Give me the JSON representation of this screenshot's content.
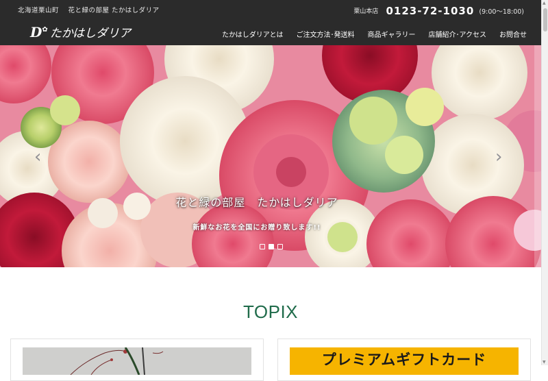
{
  "header": {
    "tagline": "北海道栗山町　 花と緑の部屋 たかはしダリア",
    "store_label": "栗山本店",
    "phone": "0123-72-1030",
    "hours": "(9:00～18:00)",
    "logo_mark": "D",
    "logo_name": "たかはしダリア"
  },
  "nav": {
    "items": [
      {
        "label": "たかはしダリアとは"
      },
      {
        "label": "ご注文方法･発送料"
      },
      {
        "label": "商品ギャラリー"
      },
      {
        "label": "店舗紹介･アクセス"
      },
      {
        "label": "お問合せ"
      }
    ]
  },
  "hero": {
    "title": "花と緑の部屋　たかはしダリア",
    "subtitle": "新鮮なお花を全国にお贈り致します!!",
    "prev_icon": "chevron-left-icon",
    "next_icon": "chevron-right-icon",
    "slide_count": 3,
    "active_slide": 2
  },
  "topix": {
    "title": "TOPIX",
    "cards": [
      {
        "image": "flower-arrangement-photo"
      },
      {
        "image": "gift-card-banner",
        "banner_text": "プレミアムギフトカード"
      }
    ]
  },
  "colors": {
    "header_bg": "#2b2b2b",
    "accent_green": "#1f6b4a",
    "banner_yellow": "#f6b400"
  }
}
